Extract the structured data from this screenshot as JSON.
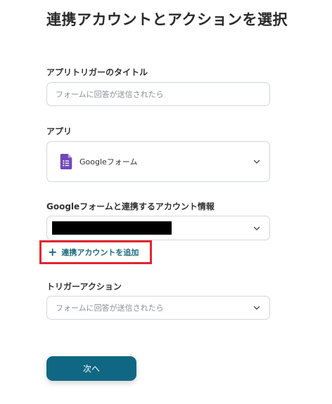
{
  "page": {
    "title": "連携アカウントとアクションを選択"
  },
  "trigger_title": {
    "label": "アプリトリガーのタイトル",
    "value": "",
    "placeholder": "フォームに回答が送信されたら"
  },
  "app": {
    "label": "アプリ",
    "selected": "Googleフォーム",
    "icon": "google-forms-icon",
    "icon_color": "#7248b9"
  },
  "account": {
    "label": "Googleフォームと連携するアカウント情報",
    "add_account_label": "連携アカウントを追加",
    "highlight_color": "#e1262f"
  },
  "trigger_action": {
    "label": "トリガーアクション",
    "selected": "フォームに回答が送信されたら"
  },
  "next_button": {
    "label": "次へ",
    "color": "#0f6783"
  }
}
